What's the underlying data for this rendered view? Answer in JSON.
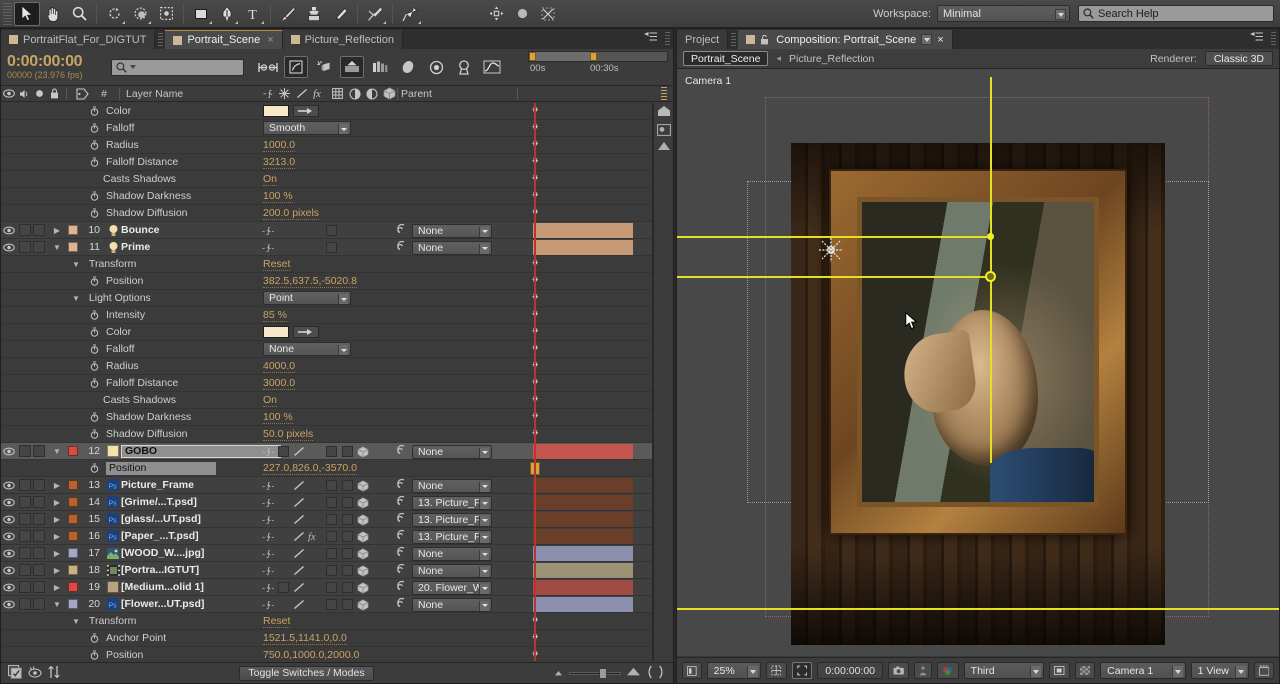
{
  "app": {
    "workspace_label": "Workspace:",
    "workspace_value": "Minimal",
    "search_placeholder": "Search Help"
  },
  "toolbar": {
    "tools": [
      {
        "name": "selection-tool",
        "glyph": "➤",
        "selected": true
      },
      {
        "name": "hand-tool",
        "glyph": "✋",
        "selected": false
      },
      {
        "name": "zoom-tool",
        "glyph": "⚲",
        "selected": false
      },
      {
        "name": "rotation-tool",
        "glyph": "↻",
        "selected": false
      },
      {
        "name": "orbit-camera-tool",
        "glyph": "◐",
        "selected": false
      },
      {
        "name": "pan-behind-tool",
        "glyph": "⌘",
        "selected": false
      },
      {
        "name": "shape-tool",
        "glyph": "■",
        "selected": false
      },
      {
        "name": "pen-tool",
        "glyph": "✒",
        "selected": false
      },
      {
        "name": "type-tool",
        "glyph": "T",
        "selected": false
      },
      {
        "name": "brush-tool",
        "glyph": "╱",
        "selected": false
      },
      {
        "name": "clone-stamp-tool",
        "glyph": "⚓",
        "selected": false
      },
      {
        "name": "eraser-tool",
        "glyph": "▱",
        "selected": false
      },
      {
        "name": "roto-brush-tool",
        "glyph": "✒",
        "selected": false
      },
      {
        "name": "puppet-pin-tool",
        "glyph": "⚑",
        "selected": false
      }
    ]
  },
  "timeline": {
    "tabs": [
      {
        "label": "PortraitFlat_For_DIGTUT",
        "active": false,
        "closable": false
      },
      {
        "label": "Portrait_Scene",
        "active": true,
        "closable": true
      },
      {
        "label": "Picture_Reflection",
        "active": false,
        "closable": false
      }
    ],
    "timecode": "0:00:00:00",
    "frame_info": "00000 (23.976 fps)",
    "search_placeholder": "",
    "ruler_labels": [
      "00s",
      "00:30s"
    ],
    "columns": {
      "layer_name": "Layer Name",
      "number": "#",
      "parent": "Parent"
    },
    "footer_button": "Toggle Switches / Modes",
    "rows": [
      {
        "kind": "prop",
        "indent": 3,
        "name": "Color",
        "value_type": "color",
        "swatch": "#f6e8c8",
        "stopwatch": true
      },
      {
        "kind": "prop",
        "indent": 3,
        "name": "Falloff",
        "value_type": "dropdown",
        "value": "Smooth",
        "stopwatch": true
      },
      {
        "kind": "prop",
        "indent": 3,
        "name": "Radius",
        "value_type": "text",
        "value": "1000.0",
        "stopwatch": true
      },
      {
        "kind": "prop",
        "indent": 3,
        "name": "Falloff Distance",
        "value_type": "text",
        "value": "3213.0",
        "stopwatch": true
      },
      {
        "kind": "prop",
        "indent": 3,
        "name": "Casts Shadows",
        "value_type": "text",
        "value": "On",
        "stopwatch": false
      },
      {
        "kind": "prop",
        "indent": 3,
        "name": "Shadow Darkness",
        "value_type": "text",
        "value": "100 %",
        "stopwatch": true
      },
      {
        "kind": "prop",
        "indent": 3,
        "name": "Shadow Diffusion",
        "value_type": "text",
        "value": "200.0  pixels",
        "stopwatch": true
      },
      {
        "kind": "layer",
        "num": "10",
        "name": "Bounce",
        "icon": "light-icon",
        "label_color": "#e0b391",
        "twirl": "closed",
        "parent": "None",
        "bar_color": "#c79a76",
        "switches": "light"
      },
      {
        "kind": "layer",
        "num": "11",
        "name": "Prime",
        "icon": "light-icon",
        "label_color": "#e0b391",
        "twirl": "open",
        "parent": "None",
        "bar_color": "#c79a76",
        "switches": "light"
      },
      {
        "kind": "prop",
        "indent": 2,
        "name": "Transform",
        "value_type": "link",
        "value": "Reset",
        "twirl": "open"
      },
      {
        "kind": "prop",
        "indent": 3,
        "name": "Position",
        "value_type": "text",
        "value": "382.5,637.5,-5020.8",
        "stopwatch": true
      },
      {
        "kind": "prop",
        "indent": 2,
        "name": "Light Options",
        "value_type": "dropdown",
        "value": "Point",
        "twirl": "open"
      },
      {
        "kind": "prop",
        "indent": 3,
        "name": "Intensity",
        "value_type": "text",
        "value": "85 %",
        "stopwatch": true
      },
      {
        "kind": "prop",
        "indent": 3,
        "name": "Color",
        "value_type": "color",
        "swatch": "#f6e8c8",
        "stopwatch": true
      },
      {
        "kind": "prop",
        "indent": 3,
        "name": "Falloff",
        "value_type": "dropdown",
        "value": "None",
        "stopwatch": true
      },
      {
        "kind": "prop",
        "indent": 3,
        "name": "Radius",
        "value_type": "text",
        "value": "4000.0",
        "stopwatch": true
      },
      {
        "kind": "prop",
        "indent": 3,
        "name": "Falloff Distance",
        "value_type": "text",
        "value": "3000.0",
        "stopwatch": true
      },
      {
        "kind": "prop",
        "indent": 3,
        "name": "Casts Shadows",
        "value_type": "text",
        "value": "On",
        "stopwatch": false
      },
      {
        "kind": "prop",
        "indent": 3,
        "name": "Shadow Darkness",
        "value_type": "text",
        "value": "100 %",
        "stopwatch": true
      },
      {
        "kind": "prop",
        "indent": 3,
        "name": "Shadow Diffusion",
        "value_type": "text",
        "value": "50.0  pixels",
        "stopwatch": true
      },
      {
        "kind": "layer",
        "num": "12",
        "name": "GOBO",
        "icon": "solid-icon",
        "label_color": "#d94b42",
        "twirl": "open",
        "parent": "None",
        "bar_color": "#c4564f",
        "selected": true,
        "editing": true,
        "swatch": "#f4e2ad"
      },
      {
        "kind": "prop",
        "indent": 3,
        "name": "Position",
        "value_type": "text",
        "value": "227.0,826.0,-3570.0",
        "stopwatch": true,
        "highlighted": true
      },
      {
        "kind": "layer",
        "num": "13",
        "name": "Picture_Frame",
        "icon": "psd-icon",
        "label_color": "#b5622f",
        "twirl": "closed",
        "parent": "None",
        "bar_color": "#6b3e29"
      },
      {
        "kind": "layer",
        "num": "14",
        "name": "[Grime/...T.psd]",
        "icon": "psd-icon",
        "label_color": "#b5622f",
        "twirl": "closed",
        "parent": "13. Picture_F",
        "bar_color": "#6b3e29"
      },
      {
        "kind": "layer",
        "num": "15",
        "name": "[glass/...UT.psd]",
        "icon": "psd-icon",
        "label_color": "#b5622f",
        "twirl": "closed",
        "parent": "13. Picture_F",
        "bar_color": "#6b3e29"
      },
      {
        "kind": "layer",
        "num": "16",
        "name": "[Paper_...T.psd]",
        "icon": "psd-icon",
        "label_color": "#b5622f",
        "twirl": "closed",
        "parent": "13. Picture_F",
        "bar_color": "#6b3e29",
        "fx": true
      },
      {
        "kind": "layer",
        "num": "17",
        "name": "[WOOD_W....jpg]",
        "icon": "jpg-icon",
        "label_color": "#a6a6c8",
        "twirl": "closed",
        "parent": "None",
        "bar_color": "#8a8fae"
      },
      {
        "kind": "layer",
        "num": "18",
        "name": "[Portra...IGTUT]",
        "icon": "comp-icon",
        "label_color": "#c9b184",
        "twirl": "closed",
        "parent": "None",
        "bar_color": "#9c9275"
      },
      {
        "kind": "layer",
        "num": "19",
        "name": "[Medium...olid 1]",
        "icon": "solid-icon",
        "label_color": "#d94b42",
        "twirl": "closed",
        "parent": "20. Flower_W",
        "bar_color": "#a24a44",
        "swatch": "#b9a183"
      },
      {
        "kind": "layer",
        "num": "20",
        "name": "[Flower...UT.psd]",
        "icon": "psd-icon",
        "label_color": "#a6a6c8",
        "twirl": "open",
        "parent": "None",
        "bar_color": "#8a8fae"
      },
      {
        "kind": "prop",
        "indent": 2,
        "name": "Transform",
        "value_type": "link",
        "value": "Reset",
        "twirl": "open"
      },
      {
        "kind": "prop",
        "indent": 3,
        "name": "Anchor Point",
        "value_type": "text",
        "value": "1521.5,1141.0,0.0",
        "stopwatch": true
      },
      {
        "kind": "prop",
        "indent": 3,
        "name": "Position",
        "value_type": "text",
        "value": "750.0,1000.0,2000.0",
        "stopwatch": true
      }
    ]
  },
  "composition": {
    "tabs": [
      {
        "label": "Project",
        "active": false
      },
      {
        "label": "Composition: Portrait_Scene",
        "active": true
      }
    ],
    "breadcrumb_active": "Portrait_Scene",
    "breadcrumb_next": "Picture_Reflection",
    "renderer_label": "Renderer:",
    "renderer_value": "Classic 3D",
    "camera_label": "Camera 1",
    "footer": {
      "zoom": "25%",
      "timecode": "0:00:00:00",
      "resolution": "Third",
      "view_camera": "Camera 1",
      "view_layout": "1 View"
    }
  },
  "colors": {
    "accent_orange": "#c8a464",
    "guide_yellow": "#e5e122",
    "playhead_red": "#c03232",
    "panel_bg": "#3b3b3b"
  }
}
